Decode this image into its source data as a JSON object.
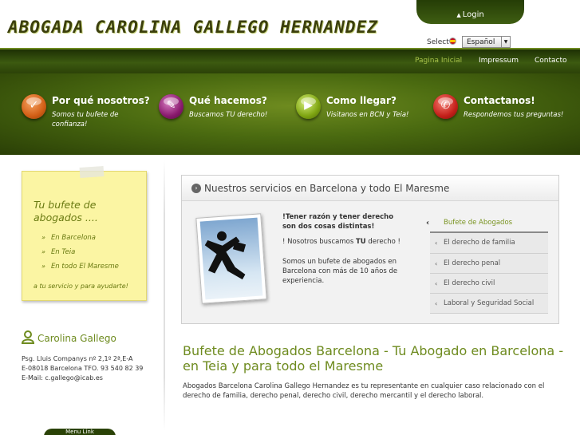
{
  "header": {
    "logo_text": "ABOGADA CAROLINA GALLEGO HERNANDEZ",
    "login_label": "Login",
    "select_label": "Select",
    "language": "Español"
  },
  "nav": {
    "items": [
      {
        "label": "Pagina Inicial"
      },
      {
        "label": "Impressum"
      },
      {
        "label": "Contacto"
      }
    ]
  },
  "features": [
    {
      "title": "Por qué nosotros?",
      "subtitle": "Somos tu bufete de confianza!",
      "icon": "check-icon",
      "color": "#d25f16"
    },
    {
      "title": "Qué hacemos?",
      "subtitle": "Buscamos TU derecho!",
      "icon": "pencil-icon",
      "color": "#8a1a6e"
    },
    {
      "title": "Como llegar?",
      "subtitle": "Visitanos en BCN y Teia!",
      "icon": "play-icon",
      "color": "#7fa512"
    },
    {
      "title": "Contactanos!",
      "subtitle": "Respondemos tus preguntas!",
      "icon": "phone-icon",
      "color": "#c4201a"
    }
  ],
  "note": {
    "title": "Tu bufete de abogados ....",
    "items": [
      "En Barcelona",
      "En Teia",
      "En todo El Maresme"
    ],
    "footer": "a tu servicio y para ayudarte!"
  },
  "contact": {
    "name": "Carolina Gallego",
    "address1": "Psg. Lluis Companys nº 2,1º 2ª,E-A",
    "address2": "E-08018 Barcelona TFO. 93 540 82 39",
    "email": "E-Mail: c.gallego@icab.es"
  },
  "bottom_tab": "Menu Link",
  "services": {
    "title": "Nuestros servicios en Barcelona y todo El Maresme",
    "text1": "!Tener razón y tener derecho son dos cosas distintas!",
    "text2_prefix": "! Nosotros buscamos ",
    "text2_bold": "TU",
    "text2_suffix": " derecho !",
    "text3": "Somos un bufete de abogados en Barcelona con más de 10 años de experiencia.",
    "menu": [
      {
        "label": "Bufete de Abogados",
        "active": true
      },
      {
        "label": "El derecho de familia",
        "active": false
      },
      {
        "label": "El derecho penal",
        "active": false
      },
      {
        "label": "El derecho civil",
        "active": false
      },
      {
        "label": "Laboral y Seguridad Social",
        "active": false
      }
    ]
  },
  "main": {
    "title": "Bufete de Abogados Barcelona - Tu Abogado en Barcelona - en Teia y para todo el Maresme",
    "body": "Abogados Barcelona Carolina Gallego Hernandez es tu representante en cualquier caso relacionado con el derecho de familia, derecho penal, derecho civil, derecho mercantil y el derecho laboral."
  }
}
